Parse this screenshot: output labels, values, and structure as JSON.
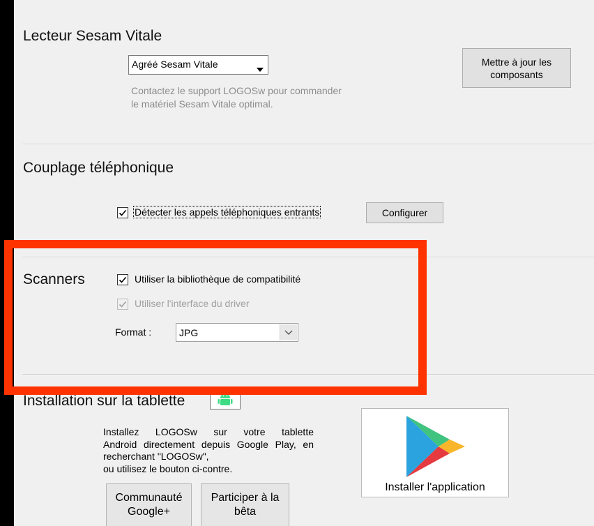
{
  "sesam": {
    "title": "Lecteur Sesam Vitale",
    "reader_select": "Agréé Sesam Vitale",
    "hint_line1": "Contactez le support LOGOSw pour commander",
    "hint_line2": "le matériel Sesam Vitale optimal.",
    "update_button_line1": "Mettre à jour les",
    "update_button_line2": "composants"
  },
  "couplage": {
    "title": "Couplage téléphonique",
    "detect_checkbox_label": "Détecter les appels téléphoniques entrants",
    "detect_checked": true,
    "configure_button": "Configurer"
  },
  "scanners": {
    "title": "Scanners",
    "compat_checkbox_label": "Utiliser la bibliothèque de compatibilité",
    "compat_checked": true,
    "driver_checkbox_label": "Utiliser l'interface du driver",
    "driver_checked": true,
    "driver_disabled": true,
    "format_label": "Format :",
    "format_value": "JPG"
  },
  "tablet": {
    "title": "Installation sur la tablette",
    "desc_line1": "Installez LOGOSw sur votre tablette",
    "desc_line2": "Android directement depuis Google Play, en",
    "desc_line3": "recherchant \"LOGOSw\",",
    "desc_line4": "ou utilisez le bouton ci-contre.",
    "install_button": "Installer l'application",
    "tab1_line1": "Communauté",
    "tab1_line2": "Google+",
    "tab2_line1": "Participer à la",
    "tab2_line2": "bêta",
    "android_icon": "android-icon",
    "play_icon": "google-play-icon"
  },
  "colors": {
    "highlight": "#ff3300",
    "android_green": "#3ddc84"
  }
}
